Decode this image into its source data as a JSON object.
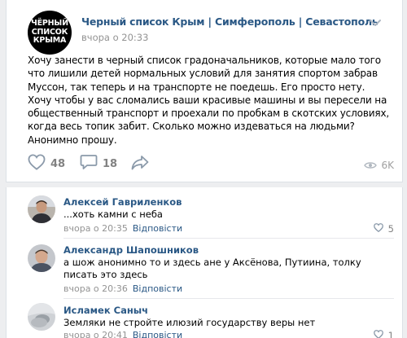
{
  "post": {
    "group_logo_lines": [
      "ЧЁРНЫЙ",
      "СПИСОК",
      "КРЫМА"
    ],
    "group_name": "Черный список Крым | Симферополь | Севастополь",
    "time": "вчора о 20:33",
    "text": "Хочу занести в черный список градоначальников, которые мало того что лишили детей нормальных условий для занятия спортом забрав Муссон, так теперь и на транспорте не поедешь. Его просто нету. Хочу чтобы у вас сломались ваши красивые машины и вы пересели на общественный транспорт и проехали по пробкам в скотских условиях, когда весь топик забит. Сколько можно издеваться на людьми? Анонимно прошу.",
    "likes": "48",
    "comments": "18",
    "views": "6K",
    "icons": {
      "like": "heart-icon",
      "comment": "comment-icon",
      "share": "share-icon",
      "views": "eye-icon",
      "more": "chevron-down-icon"
    }
  },
  "comments": [
    {
      "author": "Алексей Гавриленков",
      "text": "...хоть камни с неба",
      "time": "вчора о 20:35",
      "reply": "Відповісти",
      "likes": "5"
    },
    {
      "author": "Александр Шапошников",
      "text": "а шож анонимно то и здесь ане у Аксёнова, Путиина, толку писать это здесь",
      "time": "вчора о 20:36",
      "reply": "Відповісти",
      "likes": ""
    },
    {
      "author": "Исламек Саныч",
      "text": "Земляки не стройте илюзий государству веры нет",
      "time": "вчора о 20:41",
      "reply": "Відповісти",
      "likes": "1"
    }
  ],
  "colors": {
    "link": "#2a5885",
    "meta": "#939393",
    "background": "#edeef0"
  }
}
